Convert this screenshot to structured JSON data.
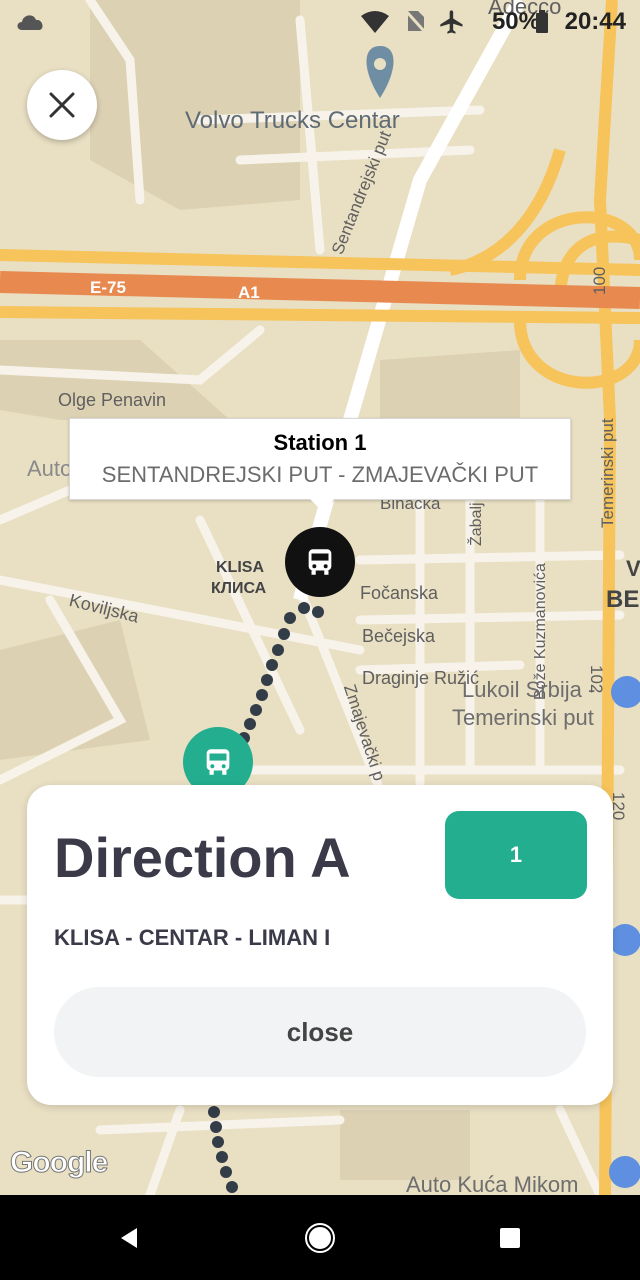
{
  "status_bar": {
    "battery": "50%",
    "time": "20:44"
  },
  "map": {
    "labels": {
      "volvo": "Volvo Trucks Centar",
      "e75": "E-75",
      "a1": "A1",
      "sentandrejski": "Sentandrejski put",
      "r100": "100",
      "olge": "Olge Penavin",
      "auto": "Auto",
      "temerinski": "Temerinski put",
      "bihacka": "Bihaćka",
      "zabalj": "Žabalj",
      "boze": "Bože Kuzmanovića",
      "klisa_lat": "KLISA",
      "klisa_cyr": "КЛИСА",
      "focanska": "Fočanska",
      "becejska": "Bečejska",
      "draginje": "Draginje Ružić",
      "koviljska": "Koviljska",
      "zmajevacki": "Zmajevački p",
      "lukoil1": "Lukoil Srbija -",
      "lukoil2": "Temerinski put",
      "r102": "102",
      "r120": "120",
      "be": "BE",
      "v_edge": "V",
      "adecco": "Adecco",
      "auto_kuca": "Auto Kuća Mikom"
    }
  },
  "callout": {
    "title": "Station 1",
    "subtitle": "SENTANDREJSKI PUT - ZMAJEVAČKI PUT"
  },
  "sheet": {
    "title": "Direction A",
    "badge": "1",
    "route": "KLISA - CENTAR - LIMAN I",
    "close_label": "close"
  },
  "google_logo": "Google",
  "colors": {
    "accent": "#22ae8f",
    "route_dots": "#333d47",
    "highway": "#e8894f",
    "major_road": "#f6c45a"
  }
}
